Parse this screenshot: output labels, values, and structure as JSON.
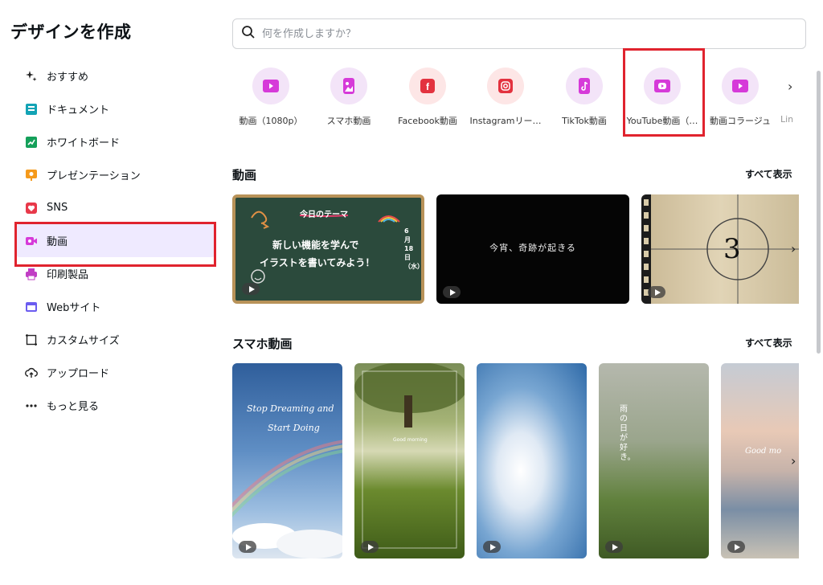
{
  "sidebar": {
    "title": "デザインを作成",
    "items": [
      {
        "label": "おすすめ",
        "icon": "sparkle-icon"
      },
      {
        "label": "ドキュメント",
        "icon": "document-icon"
      },
      {
        "label": "ホワイトボード",
        "icon": "whiteboard-icon"
      },
      {
        "label": "プレゼンテーション",
        "icon": "presentation-icon"
      },
      {
        "label": "SNS",
        "icon": "heart-icon"
      },
      {
        "label": "動画",
        "icon": "video-icon",
        "active": true
      },
      {
        "label": "印刷製品",
        "icon": "printer-icon"
      },
      {
        "label": "Webサイト",
        "icon": "website-icon"
      },
      {
        "label": "カスタムサイズ",
        "icon": "crop-icon"
      },
      {
        "label": "アップロード",
        "icon": "upload-icon"
      },
      {
        "label": "もっと見る",
        "icon": "more-icon"
      }
    ]
  },
  "search": {
    "placeholder": "何を作成しますか？"
  },
  "categories": [
    {
      "label": "動画（1080p）",
      "color": "#f3e4f8",
      "icon_color": "#d63ad9"
    },
    {
      "label": "スマホ動画",
      "color": "#f3e4f8",
      "icon_color": "#d63ad9"
    },
    {
      "label": "Facebook動画",
      "color": "#fde6e6",
      "icon_color": "#e3323f"
    },
    {
      "label": "Instagramリー…",
      "color": "#fde6e6",
      "icon_color": "#e3323f"
    },
    {
      "label": "TikTok動画",
      "color": "#f3e4f8",
      "icon_color": "#d63ad9"
    },
    {
      "label": "YouTube動画（…",
      "color": "#f3e4f8",
      "icon_color": "#d63ad9"
    },
    {
      "label": "動画コラージュ",
      "color": "#f3e4f8",
      "icon_color": "#d63ad9"
    },
    {
      "label": "Lin",
      "color": "#f3e4f8",
      "icon_color": "#d63ad9"
    }
  ],
  "sections": {
    "video": {
      "title": "動画",
      "show_all": "すべて表示",
      "thumbs": [
        {
          "top": "今日のテーマ",
          "main1": "新しい機能を学んで",
          "main2": "イラストを書いてみよう！",
          "date": "6月18日（水）"
        },
        {
          "text": "今宵、奇跡が起きる"
        },
        {
          "number": "3"
        }
      ]
    },
    "mobile": {
      "title": "スマホ動画",
      "show_all": "すべて表示",
      "thumbs": [
        {
          "text1": "Stop Dreaming and",
          "text2": "Start Doing"
        },
        {
          "text1": "Good morning"
        },
        {},
        {
          "text1": "雨の日が好き。"
        },
        {
          "text1": "Good mo"
        }
      ]
    }
  },
  "colors": {
    "accent": "#e0232e",
    "active_bg": "#efeaff",
    "brand_purple": "#8b3dff"
  }
}
